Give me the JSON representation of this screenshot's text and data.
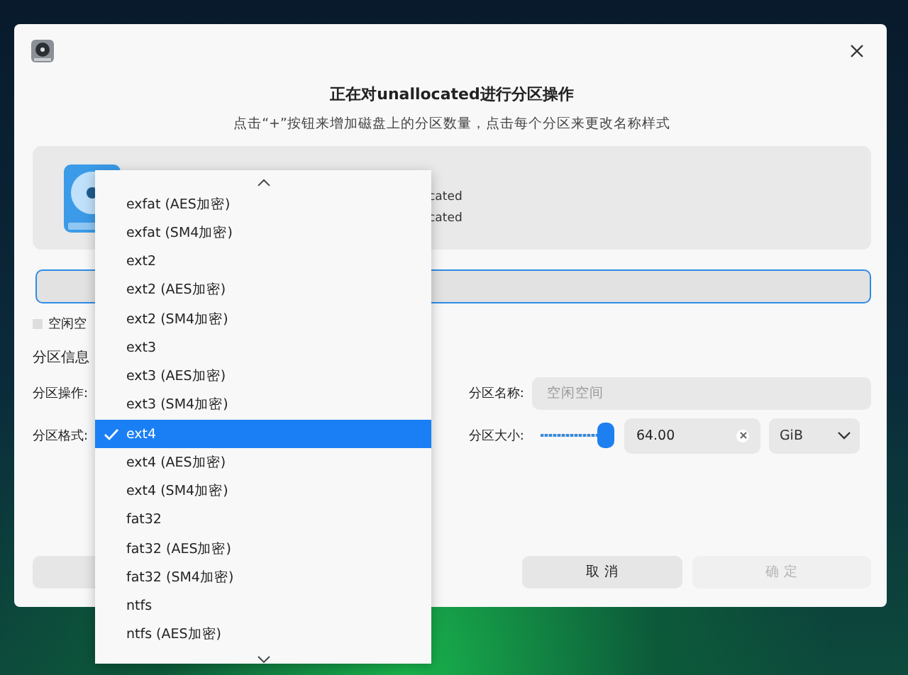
{
  "dialog": {
    "title": "正在对unallocated进行分区操作",
    "subtitle": "点击“+”按钮来增加磁盘上的分区数量，点击每个分区来更改名称样式",
    "disk_info": {
      "lines": [
        "cated",
        "cated"
      ]
    },
    "legend": {
      "label": "空闲空"
    },
    "section_title": "分区信息",
    "operation": {
      "label": "分区操作:"
    },
    "format": {
      "label": "分区格式:"
    },
    "name": {
      "label": "分区名称:",
      "placeholder": "空闲空间"
    },
    "size": {
      "label": "分区大小:",
      "level": 1,
      "value": "64.00",
      "unit": "GiB"
    },
    "buttons": [
      {
        "label": "取 消",
        "disabled": false
      },
      {
        "label": "确 定",
        "disabled": true
      }
    ]
  },
  "format_menu": {
    "items": [
      {
        "label": "exfat (AES加密)",
        "selected": false
      },
      {
        "label": "exfat (SM4加密)",
        "selected": false
      },
      {
        "label": "ext2",
        "selected": false
      },
      {
        "label": "ext2 (AES加密)",
        "selected": false
      },
      {
        "label": "ext2 (SM4加密)",
        "selected": false
      },
      {
        "label": "ext3",
        "selected": false
      },
      {
        "label": "ext3 (AES加密)",
        "selected": false
      },
      {
        "label": "ext3 (SM4加密)",
        "selected": false
      },
      {
        "label": "ext4",
        "selected": true
      },
      {
        "label": "ext4 (AES加密)",
        "selected": false
      },
      {
        "label": "ext4 (SM4加密)",
        "selected": false
      },
      {
        "label": "fat32",
        "selected": false
      },
      {
        "label": "fat32 (AES加密)",
        "selected": false
      },
      {
        "label": "fat32 (SM4加密)",
        "selected": false
      },
      {
        "label": "ntfs",
        "selected": false
      },
      {
        "label": "ntfs (AES加密)",
        "selected": false
      }
    ]
  }
}
